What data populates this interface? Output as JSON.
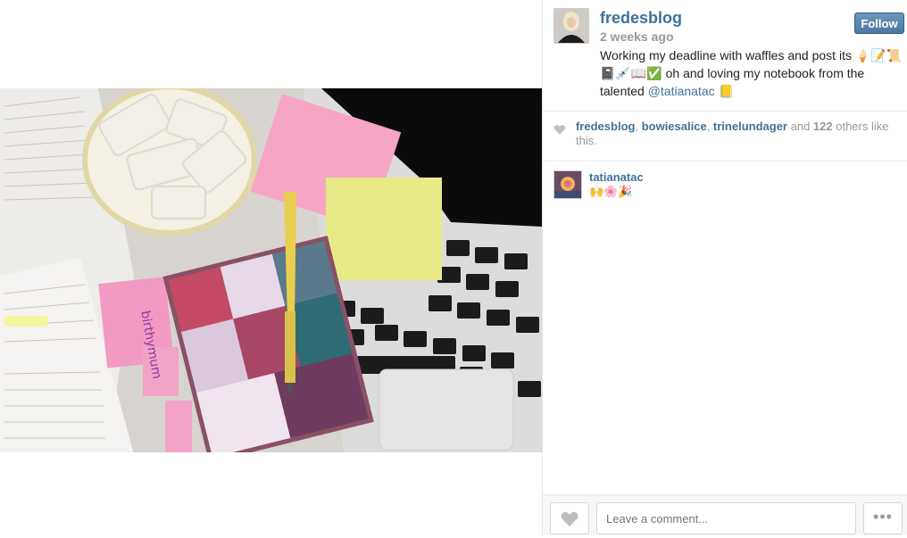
{
  "post": {
    "username": "fredesblog",
    "time": "2 weeks ago",
    "follow_label": "Follow",
    "caption_start": "Working my deadline with waffles and post its",
    "caption_emojis": "🍦📝📜📓💉📖✅",
    "caption_middle": " oh and loving my notebook from the talented ",
    "caption_mention": "@tatianatac",
    "caption_end_emoji": "📒"
  },
  "likes": {
    "user1": "fredesblog",
    "sep1": ", ",
    "user2": "bowiesalice",
    "sep2": ", ",
    "user3": "trinelundager",
    "and_text": " and ",
    "count": "122",
    "others_text": " others like this."
  },
  "comments": [
    {
      "username": "tatianatac",
      "text": "🙌🌸🎉"
    }
  ],
  "footer": {
    "comment_placeholder": "Leave a comment...",
    "more_label": "•••"
  },
  "colors": {
    "link": "#3f729b",
    "follow_button": "#4b78a3"
  },
  "icons": {
    "like_heart": "heart-icon",
    "likes_heart": "heart-icon",
    "more": "more-icon"
  }
}
